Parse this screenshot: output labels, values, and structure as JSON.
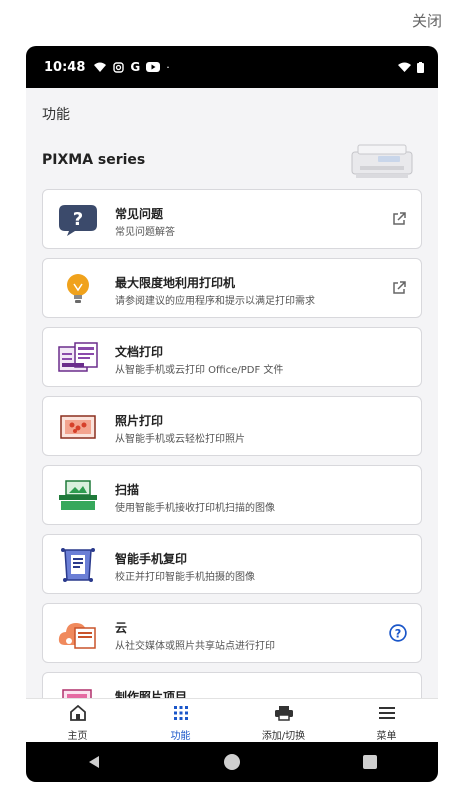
{
  "top": {
    "close_label": "关闭"
  },
  "statusbar": {
    "time": "10:48"
  },
  "appbar": {
    "title": "功能"
  },
  "series": {
    "name": "PIXMA series"
  },
  "items": [
    {
      "title": "常见问题",
      "subtitle": "常见问题解答",
      "icon": "question-bubble-icon",
      "action": "external-link-icon"
    },
    {
      "title": "最大限度地利用打印机",
      "subtitle": "请参阅建议的应用程序和提示以满足打印需求",
      "icon": "lightbulb-icon",
      "action": "external-link-icon"
    },
    {
      "title": "文档打印",
      "subtitle": "从智能手机或云打印 Office/PDF 文件",
      "icon": "document-print-icon",
      "action": ""
    },
    {
      "title": "照片打印",
      "subtitle": "从智能手机或云轻松打印照片",
      "icon": "photo-print-icon",
      "action": ""
    },
    {
      "title": "扫描",
      "subtitle": "使用智能手机接收打印机扫描的图像",
      "icon": "scan-icon",
      "action": ""
    },
    {
      "title": "智能手机复印",
      "subtitle": "校正并打印智能手机拍摄的图像",
      "icon": "smartphone-copy-icon",
      "action": ""
    },
    {
      "title": "云",
      "subtitle": "从社交媒体或照片共享站点进行打印",
      "icon": "cloud-print-icon",
      "action": "help-icon"
    },
    {
      "title": "制作照片项目",
      "subtitle": "",
      "icon": "photo-project-icon",
      "action": ""
    }
  ],
  "bottomnav": [
    {
      "label": "主页",
      "icon": "home-icon"
    },
    {
      "label": "功能",
      "icon": "grid-icon",
      "active": true
    },
    {
      "label": "添加/切换",
      "icon": "printer-icon"
    },
    {
      "label": "菜单",
      "icon": "menu-icon"
    }
  ],
  "colors": {
    "accent": "#1a56c9",
    "card_border": "#d8d8dc",
    "status_bg": "#000000"
  }
}
